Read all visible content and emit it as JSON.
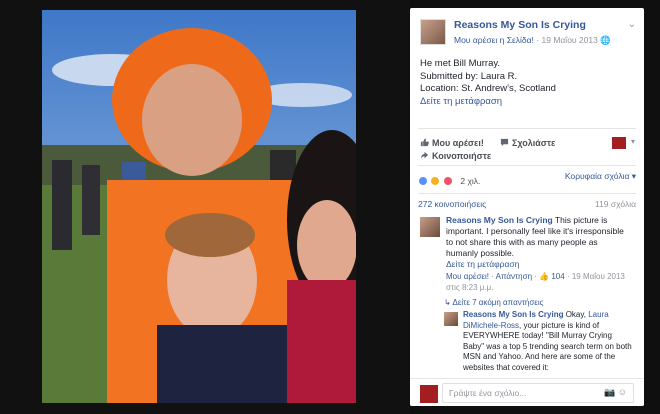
{
  "post": {
    "page_name": "Reasons My Son Is Crying",
    "like_page": "Μου αρέσει η Σελίδα!",
    "date": "19 Μαΐου 2013",
    "globe": "🌐",
    "line1": "He met Bill Murray.",
    "line2": "Submitted by: Laura R.",
    "line3": "Location: St. Andrew's, Scotland",
    "see_translation": "Δείτε τη μετάφραση"
  },
  "actions": {
    "like": "Μου αρέσει!",
    "comment": "Σχολιάστε",
    "share": "Κοινοποιήστε"
  },
  "reactions": {
    "count": "2 χιλ.",
    "sort": "Κορυφαία σχόλια ▾"
  },
  "stats": {
    "shares": "272 κοινοποιήσεις",
    "comments": "119 σχόλια"
  },
  "comment": {
    "author": "Reasons My Son Is Crying",
    "text": " This picture is important. I personally feel like it's irresponsible to not share this with as many people as humanly possible.",
    "see_translation": "Δείτε τη μετάφραση",
    "like": "Μου αρέσει!",
    "reply": "Απάντηση",
    "likes": "104",
    "date": "19 Μαΐου 2013",
    "time": "στις 8:23 μ.μ."
  },
  "replies": {
    "link": "Δείτε 7 ακόμη απαντήσεις"
  },
  "reply": {
    "author": "Reasons My Son Is Crying",
    "text_pre": " Okay, ",
    "mention": "Laura DiMichele-Ross",
    "text_post": ", your picture is kind of EVERYWHERE today! \"Bill Murray Crying Baby\" was a top 5 trending search term on both MSN and Yahoo. And here are some of the websites that covered it:"
  },
  "composer": {
    "placeholder": "Γράψτε ένα σχόλιο..."
  },
  "colors": {
    "link": "#365899",
    "muted": "#90949c",
    "background": "#0f0f10"
  }
}
